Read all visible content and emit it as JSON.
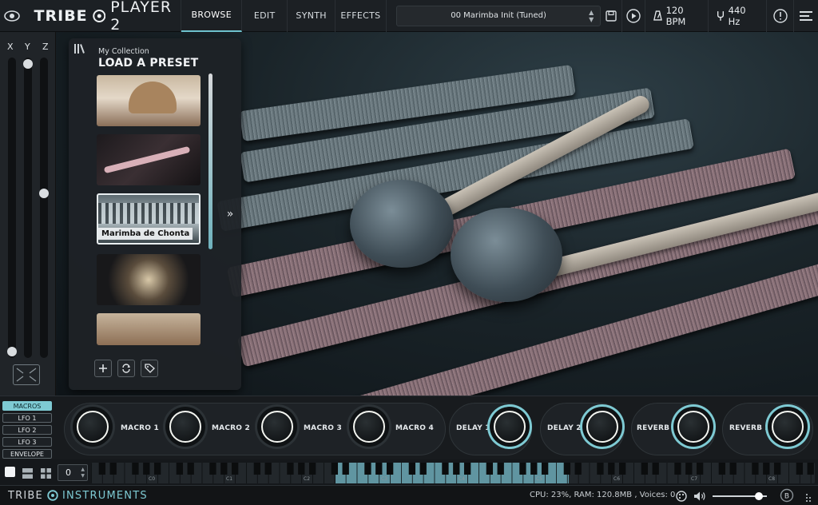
{
  "app": {
    "brand": "TRIBE",
    "product": "PLAYER 2"
  },
  "nav": {
    "tabs": [
      {
        "label": "BROWSE",
        "active": true
      },
      {
        "label": "EDIT",
        "active": false
      },
      {
        "label": "SYNTH",
        "active": false
      },
      {
        "label": "EFFECTS",
        "active": false
      }
    ]
  },
  "preset": {
    "name": "00 Marimba Init (Tuned)"
  },
  "transport": {
    "tempo": "120 BPM",
    "tuning": "440 Hz"
  },
  "xyz": {
    "labels": [
      "X",
      "Y",
      "Z"
    ],
    "levels": [
      0.0,
      1.0,
      0.55
    ]
  },
  "browser": {
    "collection": "My Collection",
    "title": "LOAD A PRESET",
    "selected_label": "Marimba de Chonta"
  },
  "modulation": {
    "tabs": [
      {
        "label": "MACROS",
        "active": true
      },
      {
        "label": "LFO 1",
        "active": false
      },
      {
        "label": "LFO 2",
        "active": false
      },
      {
        "label": "LFO 3",
        "active": false
      },
      {
        "label": "ENVELOPE",
        "active": false
      }
    ],
    "macros": [
      "MACRO 1",
      "MACRO 2",
      "MACRO 3",
      "MACRO 4"
    ],
    "effects": [
      "DELAY 1",
      "DELAY 2",
      "REVERB 1",
      "REVERB 2"
    ]
  },
  "keyboard": {
    "octave_value": "0",
    "octave_labels": [
      "C0",
      "C1",
      "C2",
      "C3",
      "C4",
      "C5",
      "C6",
      "C7",
      "C8"
    ]
  },
  "footer": {
    "brand": "TRIBE",
    "brand_suffix": "INSTRUMENTS",
    "status": "CPU: 23%, RAM: 120.8MB , Voices: 0",
    "volume_level": 0.85
  },
  "colors": {
    "accent": "#7ecad3",
    "panel": "#1e2226",
    "topbar": "#1c2024"
  }
}
